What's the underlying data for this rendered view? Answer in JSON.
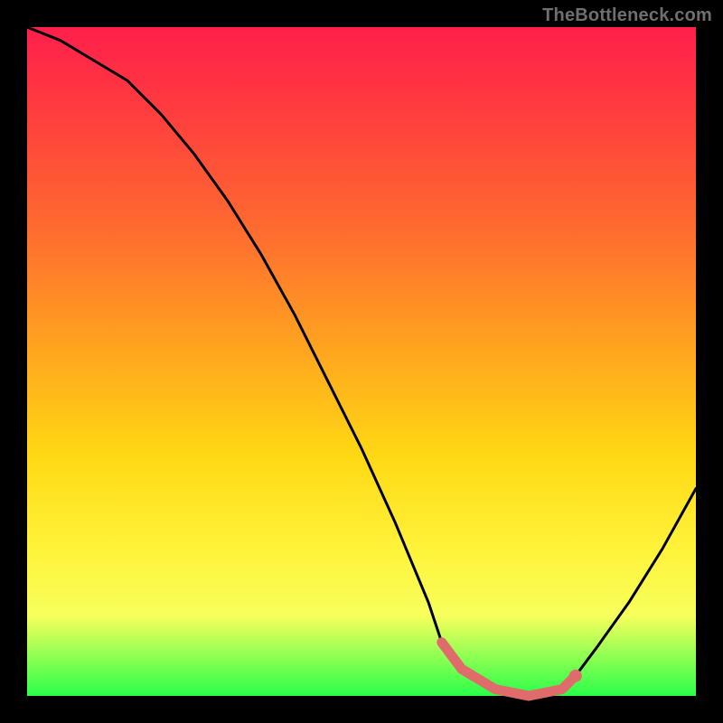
{
  "watermark": "TheBottleneck.com",
  "chart_data": {
    "type": "line",
    "title": "",
    "xlabel": "",
    "ylabel": "",
    "xlim": [
      0,
      100
    ],
    "ylim": [
      0,
      100
    ],
    "grid": false,
    "legend": false,
    "series": [
      {
        "name": "bottleneck-curve",
        "x": [
          0,
          5,
          10,
          15,
          20,
          25,
          30,
          35,
          40,
          45,
          50,
          55,
          60,
          62,
          65,
          70,
          75,
          80,
          82,
          85,
          90,
          95,
          100
        ],
        "values": [
          100,
          98,
          95,
          92,
          87,
          81,
          74,
          66,
          57,
          47,
          37,
          26,
          14,
          8,
          4,
          1,
          0,
          1,
          3,
          7,
          14,
          22,
          31
        ]
      },
      {
        "name": "optimal-range-highlight",
        "x": [
          62,
          65,
          70,
          75,
          80,
          82
        ],
        "values": [
          8,
          4,
          1,
          0,
          1,
          3
        ]
      }
    ],
    "markers": [
      {
        "name": "optimal-point",
        "x": 82,
        "y": 3
      }
    ],
    "annotations": []
  },
  "colors": {
    "curve": "#000000",
    "highlight": "#e06b6b",
    "frame": "#000000"
  }
}
